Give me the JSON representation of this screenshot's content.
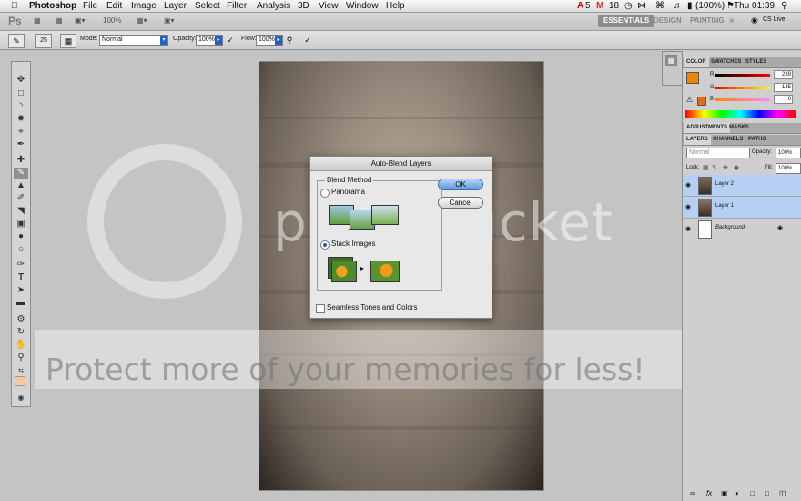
{
  "menubar": {
    "app": "Photoshop",
    "items": [
      "File",
      "Edit",
      "Image",
      "Layer",
      "Select",
      "Filter",
      "Analysis",
      "3D",
      "View",
      "Window",
      "Help"
    ],
    "status": {
      "adobe_count": "5",
      "mail_count": "18",
      "battery": "(100%)",
      "clock": "Thu 01:39"
    }
  },
  "appbar": {
    "logo": "Ps",
    "zoom": "100%",
    "workspaces": [
      "ESSENTIALS",
      "DESIGN",
      "PAINTING"
    ],
    "more": "»",
    "cslive": "CS Live"
  },
  "options": {
    "brush_size": "25",
    "mode_label": "Mode:",
    "mode_value": "Normal",
    "opacity_label": "Opacity:",
    "opacity_value": "100%",
    "flow_label": "Flow:",
    "flow_value": "100%"
  },
  "dialog": {
    "title": "Auto-Blend Layers",
    "group_title": "Blend Method",
    "option_panorama": "Panorama",
    "option_stack": "Stack Images",
    "selected": "stack",
    "seamless_label": "Seamless Tones and Colors",
    "seamless_checked": false,
    "ok": "OK",
    "cancel": "Cancel"
  },
  "color_panel": {
    "tabs": [
      "COLOR",
      "SWATCHES",
      "STYLES"
    ],
    "r": "239",
    "g": "135",
    "b": "0",
    "fg_color": "#ef8700"
  },
  "adjustments": {
    "tabs": [
      "ADJUSTMENTS",
      "MASKS"
    ]
  },
  "layers_panel": {
    "tabs": [
      "LAYERS",
      "CHANNELS",
      "PATHS"
    ],
    "blend": "Normal",
    "opacity_label": "Opacity:",
    "opacity": "100%",
    "lock_label": "Lock:",
    "fill_label": "Fill:",
    "fill": "100%",
    "layers": [
      {
        "name": "Layer 2",
        "selected": true
      },
      {
        "name": "Layer 1",
        "selected": true
      },
      {
        "name": "Background",
        "selected": false
      }
    ]
  },
  "watermark": {
    "logo": "photobucket",
    "tagline": "Protect more of your memories for less!"
  }
}
